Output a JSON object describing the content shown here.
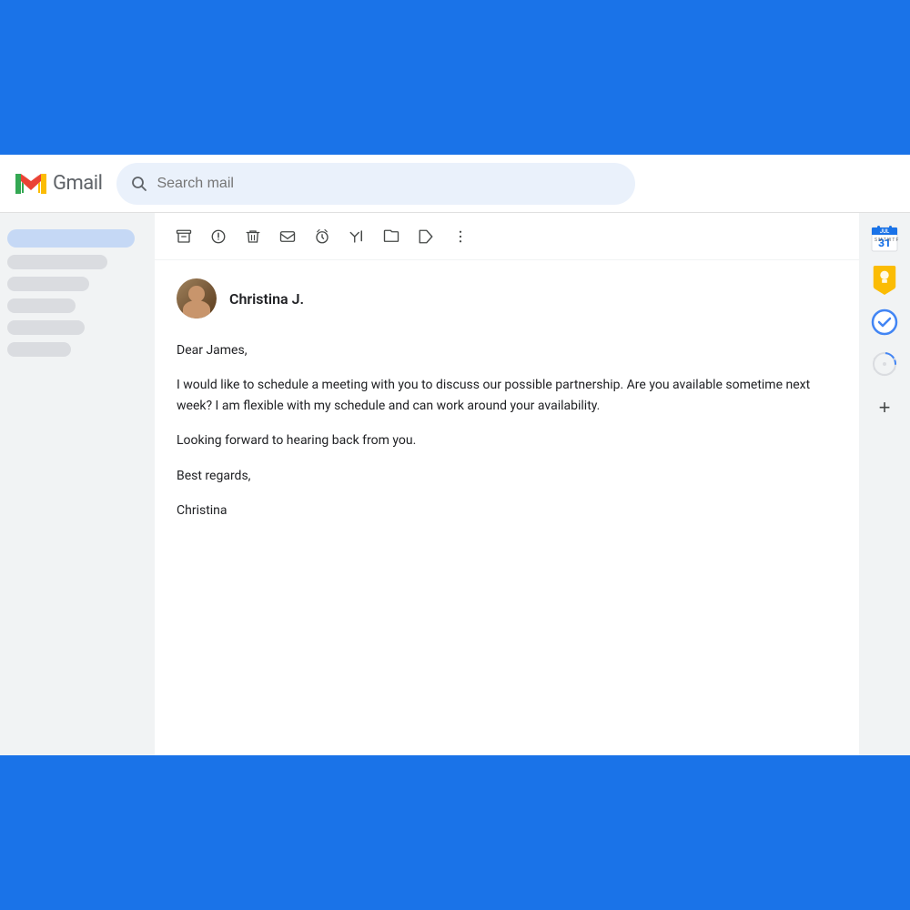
{
  "app": {
    "title": "Gmail",
    "logo_m": "M",
    "logo_label": "Gmail"
  },
  "search": {
    "placeholder": "Search mail",
    "value": ""
  },
  "toolbar": {
    "buttons": [
      {
        "name": "archive",
        "icon": "⬜",
        "label": "Archive"
      },
      {
        "name": "report-spam",
        "icon": "⚠",
        "label": "Report spam"
      },
      {
        "name": "delete",
        "icon": "🗑",
        "label": "Delete"
      },
      {
        "name": "mark-unread",
        "icon": "✉",
        "label": "Mark as unread"
      },
      {
        "name": "snooze",
        "icon": "🕐",
        "label": "Snooze"
      },
      {
        "name": "task-add",
        "icon": "✎",
        "label": "Add to tasks"
      },
      {
        "name": "move-to",
        "icon": "📁",
        "label": "Move to"
      },
      {
        "name": "label",
        "icon": "🏷",
        "label": "Label"
      },
      {
        "name": "more",
        "icon": "⋮",
        "label": "More options"
      }
    ]
  },
  "email": {
    "sender_name": "Christina J.",
    "greeting": "Dear James,",
    "body_paragraph_1": "I would like to schedule a meeting with you to discuss our possible partnership. Are you available sometime next week? I am flexible with my schedule and can work around your availability.",
    "body_paragraph_2": "Looking forward to hearing back from you.",
    "closing": "Best regards,",
    "sender_sign": "Christina"
  },
  "right_sidebar": {
    "icons": [
      {
        "name": "google-calendar",
        "label": "Google Calendar"
      },
      {
        "name": "google-keep",
        "label": "Google Keep"
      },
      {
        "name": "google-tasks",
        "label": "Google Tasks"
      },
      {
        "name": "google-contacts",
        "label": "Google Contacts"
      }
    ],
    "add_label": "+"
  }
}
